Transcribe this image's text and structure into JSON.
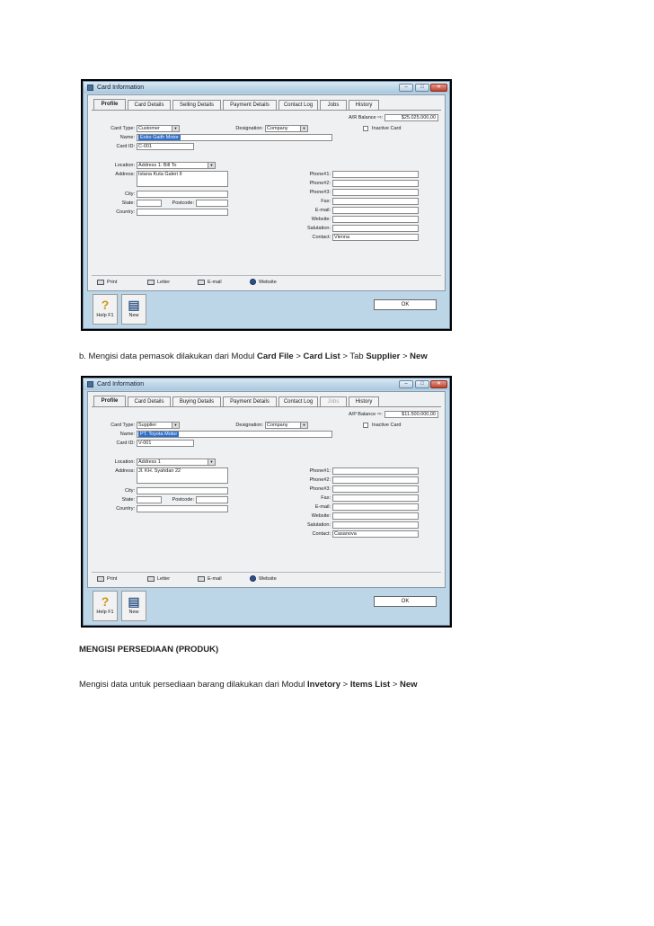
{
  "screenshots": [
    {
      "window_title": "Card Information",
      "tabs": [
        "Profile",
        "Card Details",
        "Selling Details",
        "Payment Details",
        "Contact Log",
        "Jobs",
        "History"
      ],
      "disabled_tabs": [],
      "balance_label": "A/R Balance",
      "balance_value": "$25.025.000,00",
      "card_type_label": "Card Type:",
      "card_type": "Customer",
      "designation_label": "Designation:",
      "designation": "Company",
      "inactive_label": "Inactive Card",
      "name_label": "Name:",
      "name": "Eoko Gaith Motor",
      "card_id_label": "Card ID:",
      "card_id": "C-001",
      "location_label": "Location:",
      "location": "Address 1: Bill To",
      "address_label": "Address:",
      "address": "Istana Kuta Galeri II",
      "city_label": "City:",
      "state_label": "State:",
      "postcode_label": "Postcode:",
      "country_label": "Country:",
      "phone_labels": [
        "Phone#1:",
        "Phone#2:",
        "Phone#3:",
        "Fax:",
        "E-mail:",
        "Website:",
        "Salutation:",
        "Contact:"
      ],
      "contact": "Vienna",
      "bottom_buttons": [
        "Print",
        "Letter",
        "E-mail",
        "Website"
      ],
      "help_label": "Help F1",
      "new_label": "New",
      "ok_label": "OK"
    },
    {
      "window_title": "Card Information",
      "tabs": [
        "Profile",
        "Card Details",
        "Buying Details",
        "Payment Details",
        "Contact Log",
        "Jobs",
        "History"
      ],
      "disabled_tabs": [
        "Jobs"
      ],
      "balance_label": "A/P Balance",
      "balance_value": "$11.500.000,00",
      "card_type_label": "Card Type:",
      "card_type": "Supplier",
      "designation_label": "Designation:",
      "designation": "Company",
      "inactive_label": "Inactive Card",
      "name_label": "Name:",
      "name": "PT. Toyota Motor",
      "card_id_label": "Card ID:",
      "card_id": "V-001",
      "location_label": "Location:",
      "location": "Address 1",
      "address_label": "Address:",
      "address": "Jl. KH. Syahdan 22",
      "city_label": "City:",
      "state_label": "State:",
      "postcode_label": "Postcode:",
      "country_label": "Country:",
      "phone_labels": [
        "Phone#1:",
        "Phone#2:",
        "Phone#3:",
        "Fax:",
        "E-mail:",
        "Website:",
        "Salutation:",
        "Contact:"
      ],
      "contact": "Casanova",
      "bottom_buttons": [
        "Print",
        "Letter",
        "E-mail",
        "Website"
      ],
      "help_label": "Help F1",
      "new_label": "New",
      "ok_label": "OK"
    }
  ],
  "caption1": {
    "prefix": "b. Mengisi data pemasok dilakukan dari Modul ",
    "b1": "Card File",
    "sep1": " > ",
    "b2": "Card List",
    "mid": " > Tab ",
    "b3": "Supplier",
    "sep2": " > ",
    "b4": "New"
  },
  "heading": "MENGISI PERSEDIAAN (PRODUK)",
  "caption2": {
    "prefix": "Mengisi data untuk persediaan barang dilakukan dari Modul ",
    "b1": "Invetory",
    "sep1": " > ",
    "b2": "Items List",
    "sep2": " > ",
    "b3": "New"
  }
}
